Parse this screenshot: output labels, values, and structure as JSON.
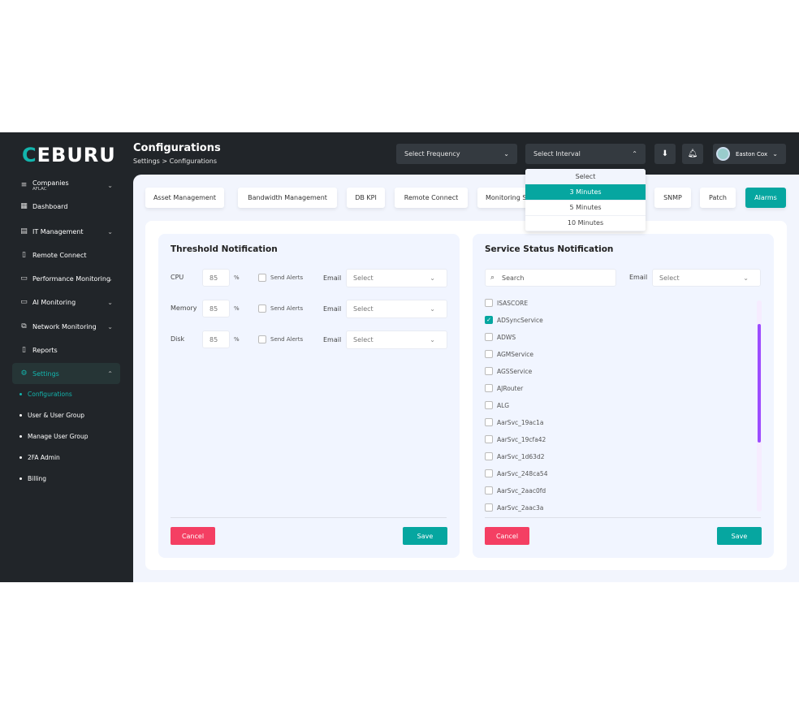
{
  "brand": {
    "logo_text": "CEBURU",
    "accent": "#06a6a0"
  },
  "header": {
    "title": "Configurations",
    "breadcrumb": "Settings > Configurations",
    "frequency_select": "Select Frequency",
    "interval_select": "Select Interval",
    "user_name": "Easton Cox"
  },
  "interval_dropdown": {
    "options": [
      "Select",
      "3 Minutes",
      "5 Minutes",
      "10 Minutes"
    ],
    "selected": "3 Minutes"
  },
  "sidebar": {
    "company": {
      "label": "Companies",
      "value": "AFLAC"
    },
    "items": [
      {
        "label": "Dashboard",
        "icon": "dashboard-icon"
      },
      {
        "label": "IT Management",
        "icon": "it-management-icon",
        "expandable": true
      },
      {
        "label": "Remote Connect",
        "icon": "remote-connect-icon"
      },
      {
        "label": "Performance Monitoring",
        "icon": "performance-icon",
        "expandable": true
      },
      {
        "label": "AI Monitoring",
        "icon": "ai-monitoring-icon",
        "expandable": true
      },
      {
        "label": "Network Monitoring",
        "icon": "network-icon",
        "expandable": true
      },
      {
        "label": "Reports",
        "icon": "reports-icon"
      },
      {
        "label": "Settings",
        "icon": "gear-icon",
        "expandable": true,
        "active": true
      }
    ],
    "sub_items": [
      {
        "label": "Configurations",
        "active": true
      },
      {
        "label": "User & User Group"
      },
      {
        "label": "Manage User Group"
      },
      {
        "label": "2FA Admin"
      },
      {
        "label": "Billing"
      }
    ]
  },
  "tabs": [
    {
      "label": "Asset Management"
    },
    {
      "label": "Bandwidth Management"
    },
    {
      "label": "DB KPI"
    },
    {
      "label": "Remote Connect"
    },
    {
      "label": "Monitoring S"
    },
    {
      "label": "SNMP"
    },
    {
      "label": "Patch"
    },
    {
      "label": "Alarms",
      "active": true
    }
  ],
  "threshold": {
    "title": "Threshold Notification",
    "rows": [
      {
        "label": "CPU",
        "value": "85",
        "unit": "%",
        "alerts_label": "Send Alerts",
        "email_label": "Email",
        "email_select": "Select"
      },
      {
        "label": "Memory",
        "value": "85",
        "unit": "%",
        "alerts_label": "Send Alerts",
        "email_label": "Email",
        "email_select": "Select"
      },
      {
        "label": "Disk",
        "value": "85",
        "unit": "%",
        "alerts_label": "Send Alerts",
        "email_label": "Email",
        "email_select": "Select"
      }
    ],
    "cancel": "Cancel",
    "save": "Save"
  },
  "service": {
    "title": "Service Status Notification",
    "search_placeholder": "Search",
    "email_label": "Email",
    "email_select": "Select",
    "services": [
      {
        "name": "ISASCORE",
        "checked": false
      },
      {
        "name": "ADSyncService",
        "checked": true
      },
      {
        "name": "ADWS",
        "checked": false
      },
      {
        "name": "AGMService",
        "checked": false
      },
      {
        "name": "AGSService",
        "checked": false
      },
      {
        "name": "AJRouter",
        "checked": false
      },
      {
        "name": "ALG",
        "checked": false
      },
      {
        "name": "AarSvc_19ac1a",
        "checked": false
      },
      {
        "name": "AarSvc_19cfa42",
        "checked": false
      },
      {
        "name": "AarSvc_1d63d2",
        "checked": false
      },
      {
        "name": "AarSvc_248ca54",
        "checked": false
      },
      {
        "name": "AarSvc_2aac0fd",
        "checked": false
      },
      {
        "name": "AarSvc_2aac3a",
        "checked": false
      }
    ],
    "cancel": "Cancel",
    "save": "Save"
  }
}
